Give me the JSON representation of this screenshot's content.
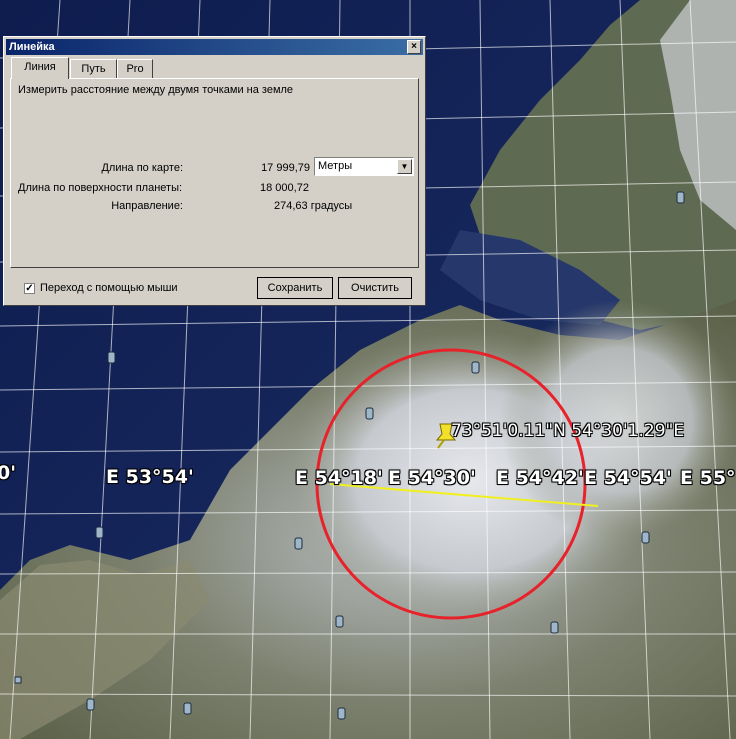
{
  "map": {
    "grid_labels": [
      "E 53°54'",
      "E 54°18'",
      "E 54°30'",
      "E 54°42'",
      "E 54°54'",
      "E 55°",
      "0'"
    ],
    "placemark_label": "73°51'0.11\"N 54°30'1.29\"E",
    "colors": {
      "circle": "#e8222a",
      "ruler_line": "#f0f020",
      "pin": "#f2e02a"
    }
  },
  "dialog": {
    "title": "Линейка",
    "close_glyph": "×",
    "tabs": [
      {
        "label": "Линия",
        "active": true
      },
      {
        "label": "Путь",
        "active": false
      },
      {
        "label": "Pro",
        "active": false
      }
    ],
    "description": "Измерить расстояние между двумя точками на земле",
    "map_length_label": "Длина по карте:",
    "map_length_value": "17 999,79",
    "units_selected": "Метры",
    "surface_length_label": "Длина по поверхности планеты:",
    "surface_length_value": "18 000,72",
    "heading_label": "Направление:",
    "heading_value": "274,63 градусы",
    "mouse_nav_label": "Переход с помощью мыши",
    "mouse_nav_checked": true,
    "save_label": "Сохранить",
    "clear_label": "Очистить"
  }
}
